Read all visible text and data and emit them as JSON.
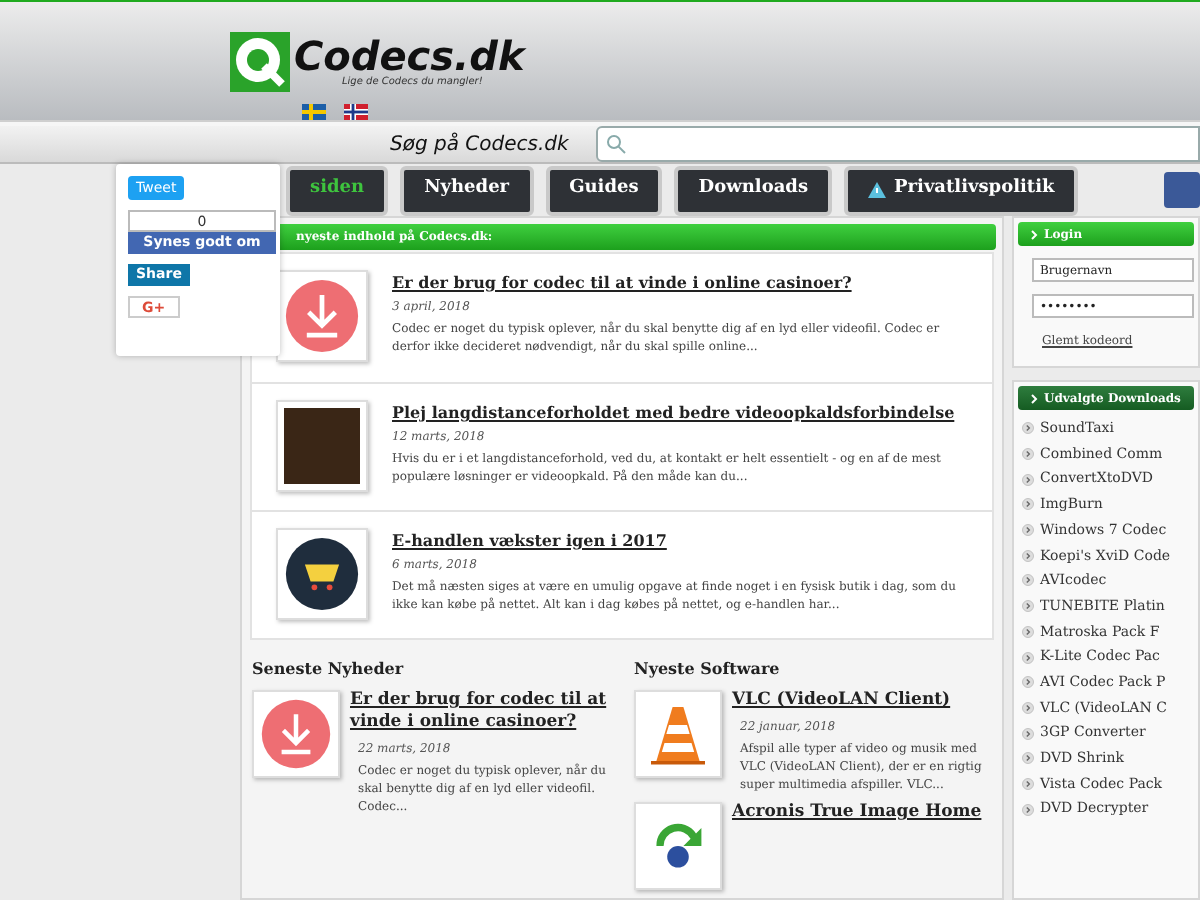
{
  "header": {
    "logo_text": "Codecs.dk",
    "tagline": "Lige de Codecs du mangler!",
    "flags": [
      {
        "kind": "sweden"
      },
      {
        "kind": "norway"
      }
    ]
  },
  "search": {
    "label": "Søg på Codecs.dk"
  },
  "nav": [
    {
      "label": "siden",
      "selected": true,
      "kind": "plain"
    },
    {
      "label": "Nyheder",
      "selected": false,
      "kind": "plain"
    },
    {
      "label": "Guides",
      "selected": false,
      "kind": "plain"
    },
    {
      "label": "Downloads",
      "selected": false,
      "kind": "plain"
    },
    {
      "label": "Privatlivspolitik",
      "selected": false,
      "kind": "warning"
    }
  ],
  "social": {
    "tweet": "Tweet",
    "like_count": "0",
    "like": "Synes godt om",
    "share": "Share",
    "gplus": "G+"
  },
  "latest": {
    "heading": "nyeste indhold på Codecs.dk:",
    "articles": [
      {
        "kind": "download",
        "title": "Er der brug for codec til at vinde i online casinoer?",
        "date": "3 april, 2018",
        "text": "Codec er noget du typisk oplever, når du skal benytte dig af en lyd eller videofil. Codec er derfor ikke decideret nødvendigt, når du skal spille online..."
      },
      {
        "kind": "photo",
        "title": "Plej langdistanceforholdet med bedre videoopkaldsforbindelse",
        "date": "12 marts, 2018",
        "text": "Hvis du er i et langdistanceforhold, ved du, at kontakt er helt essentielt - og en af de mest populære løsninger er videoopkald. På den måde kan du..."
      },
      {
        "kind": "cart",
        "title": "E-handlen vækster igen i 2017",
        "date": "6 marts, 2018",
        "text": "Det må næsten siges at være en umulig opgave at finde noget i en fysisk butik i dag, som du ikke kan købe på nettet. Alt kan i dag købes på nettet, og e-handlen har..."
      }
    ]
  },
  "news": {
    "heading": "Seneste Nyheder",
    "items": [
      {
        "kind": "download",
        "title": "Er der brug for codec til at vinde i online casinoer?",
        "date": "22 marts, 2018",
        "text": "Codec er noget du typisk oplever, når du skal benytte dig af en lyd eller videofil. Codec..."
      }
    ]
  },
  "software": {
    "heading": "Nyeste Software",
    "items": [
      {
        "kind": "cone",
        "title": "VLC (VideoLAN Client)",
        "date": "22 januar, 2018",
        "text": "Afspil alle typer af video og musik med VLC (VideoLAN Client), der er en rigtig super multimedia afspiller. VLC..."
      },
      {
        "kind": "recycle",
        "title": "Acronis True Image Home"
      }
    ]
  },
  "login": {
    "heading": "Login",
    "username_placeholder": "Brugernavn",
    "password_value": "••••••••",
    "forgot": "Glemt kodeord"
  },
  "downloads": {
    "heading": "Udvalgte Downloads",
    "items": [
      "SoundTaxi",
      "Combined Comm",
      "ConvertXtoDVD",
      "ImgBurn",
      "Windows 7 Codec",
      "Koepi's XviD Code",
      "AVIcodec",
      "TUNEBITE Platin",
      "Matroska Pack F",
      "K-Lite Codec Pac",
      "AVI Codec Pack P",
      "VLC (VideoLAN C",
      "3GP Converter",
      "DVD Shrink",
      "Vista Codec Pack",
      "DVD Decrypter"
    ]
  }
}
